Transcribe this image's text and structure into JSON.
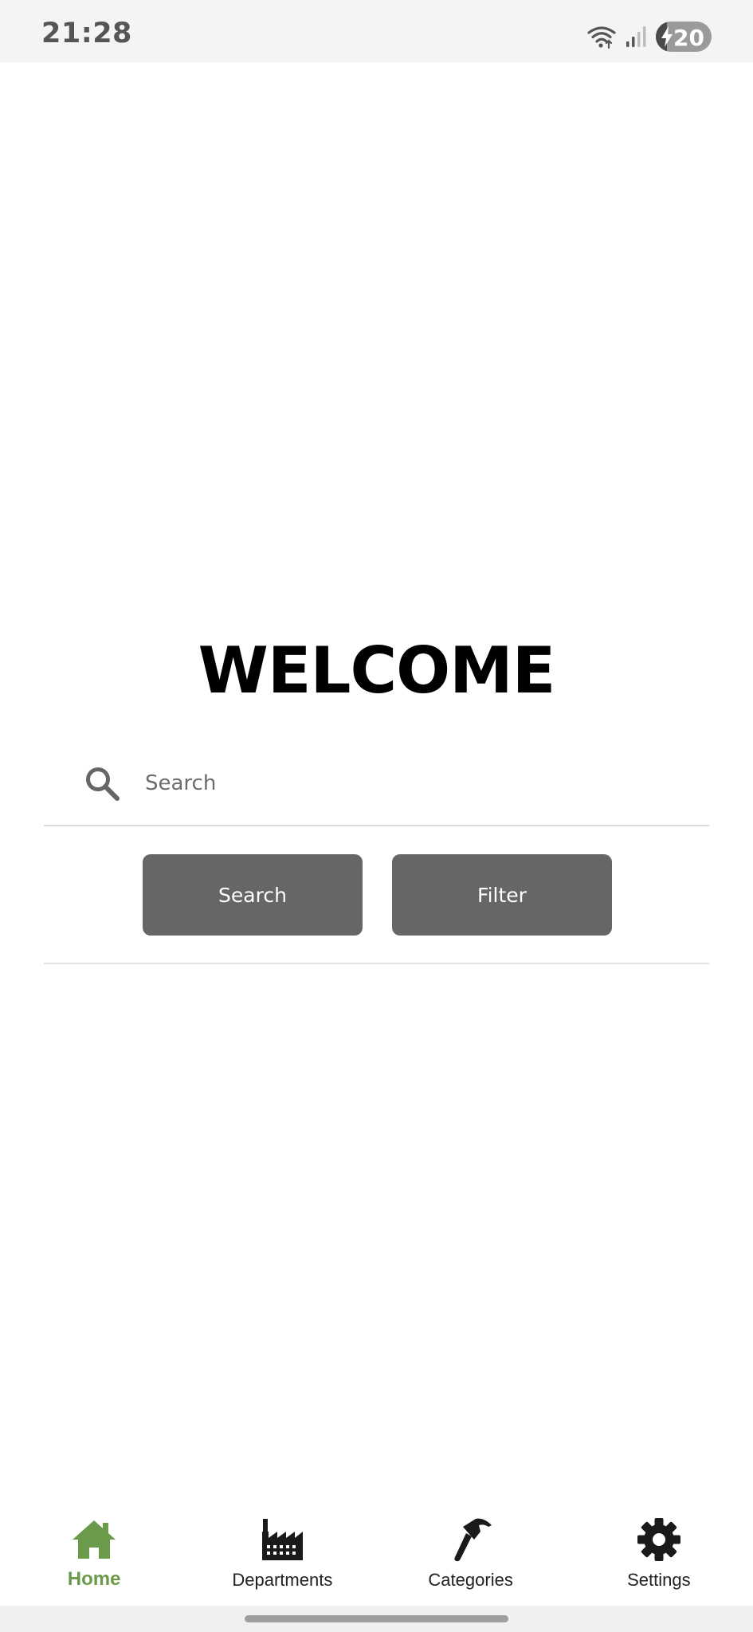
{
  "status_bar": {
    "time": "21:28",
    "battery_level": "20",
    "battery_charging": true,
    "icons": [
      "wifi-icon",
      "signal-icon",
      "battery-icon"
    ]
  },
  "main": {
    "title": "WELCOME",
    "search": {
      "placeholder": "Search",
      "value": ""
    },
    "search_button_label": "Search",
    "filter_button_label": "Filter"
  },
  "bottom_nav": {
    "items": [
      {
        "label": "Home",
        "icon": "home-icon",
        "active": true
      },
      {
        "label": "Departments",
        "icon": "factory-icon",
        "active": false
      },
      {
        "label": "Categories",
        "icon": "hammer-icon",
        "active": false
      },
      {
        "label": "Settings",
        "icon": "gear-icon",
        "active": false
      }
    ]
  },
  "colors": {
    "accent": "#6a9a4a",
    "button_bg": "#666666",
    "status_bar_bg": "#f4f4f4"
  }
}
